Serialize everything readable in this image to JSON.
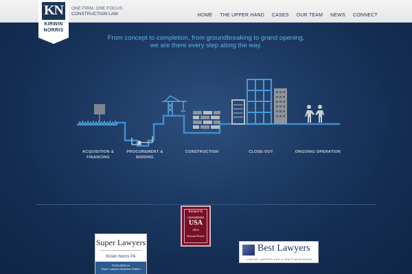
{
  "header": {
    "logo_mark": "KN",
    "logo_line1": "KIRWIN",
    "logo_line2": "NORRIS",
    "tagline_line1": "ONE FIRM. ONE FOCUS.",
    "tagline_line2": "CONSTRUCTION LAW",
    "nav": [
      {
        "label": "HOME"
      },
      {
        "label": "THE UPPER HAND"
      },
      {
        "label": "CASES"
      },
      {
        "label": "OUR TEAM"
      },
      {
        "label": "NEWS"
      },
      {
        "label": "CONNECT"
      }
    ]
  },
  "main": {
    "headline": "From concept to completion, from groundbreaking to grand opening, we are there every step along the way.",
    "stages": [
      {
        "line1": "ACQUISITION &",
        "line2": "FINANCING"
      },
      {
        "line1": "PROCUREMENT &",
        "line2": "BIDDING"
      },
      {
        "line1": "CONSTRUCTION",
        "line2": ""
      },
      {
        "line1": "CLOSE-OUT",
        "line2": ""
      },
      {
        "line1": "ONGOING OPERATION",
        "line2": ""
      }
    ]
  },
  "badges": {
    "super_lawyers": {
      "title": "Super Lawyers",
      "name": "Kirwin Norris PA",
      "featured_line1": "FEATURED IN",
      "featured_line2": "Super Lawyers Business Edition"
    },
    "chambers": {
      "line1": "Ranked In",
      "line2": "CHAMBERS",
      "line3": "USA",
      "line4": "2013",
      "line5": "Kirwin Norris"
    },
    "best_lawyers": {
      "title": "Best Lawyers",
      "tagline": "LINKING LAWYERS AND CLIENTS WORLDWIDE"
    }
  },
  "colors": {
    "accent_blue": "#5fb0e4",
    "background": "#1d3a64",
    "chambers_red": "#7a1028"
  }
}
